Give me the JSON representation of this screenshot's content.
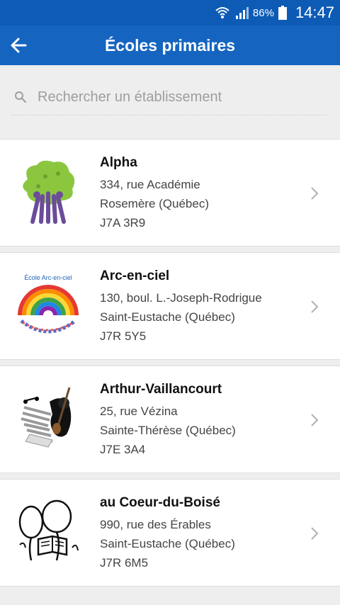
{
  "status": {
    "battery": "86%",
    "time": "14:47"
  },
  "header": {
    "title": "Écoles primaires"
  },
  "search": {
    "placeholder": "Rechercher un établissement"
  },
  "schools": [
    {
      "name": "Alpha",
      "street": "334, rue Académie",
      "city": "Rosemère (Québec)",
      "postal": "J7A 3R9"
    },
    {
      "name": "Arc-en-ciel",
      "street": "130, boul. L.-Joseph-Rodrigue",
      "city": "Saint-Eustache (Québec)",
      "postal": "J7R 5Y5",
      "logo_text": "École Arc-en-ciel"
    },
    {
      "name": "Arthur-Vaillancourt",
      "street": "25, rue Vézina",
      "city": "Sainte-Thérèse (Québec)",
      "postal": "J7E 3A4"
    },
    {
      "name": "au Coeur-du-Boisé",
      "street": "990, rue des Érables",
      "city": "Saint-Eustache (Québec)",
      "postal": "J7R 6M5"
    }
  ],
  "colors": {
    "appbar": "#1565c0",
    "statusbar": "#0d5bb5",
    "background": "#eeeeee"
  }
}
